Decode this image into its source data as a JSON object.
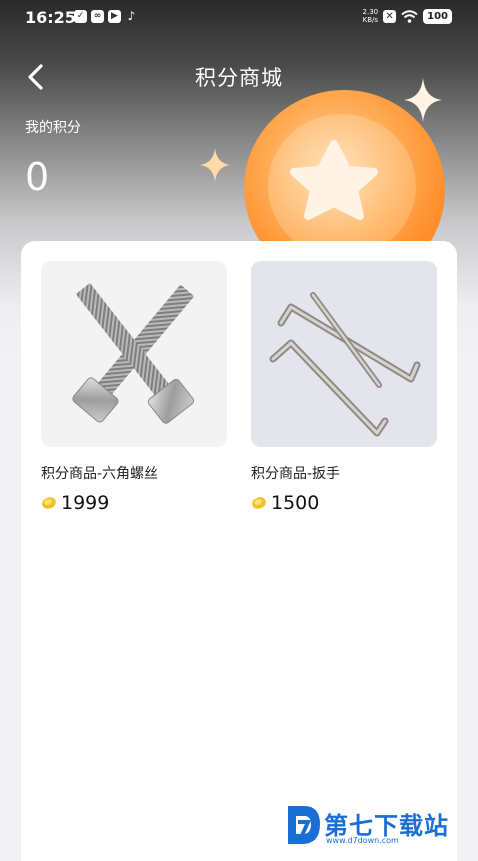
{
  "status_bar": {
    "time": "16:25",
    "speed_value": "2.30",
    "speed_unit": "KB/s",
    "battery": "100"
  },
  "header": {
    "title": "积分商城"
  },
  "points": {
    "label": "我的积分",
    "value": "0"
  },
  "products": [
    {
      "name": "积分商品-六角螺丝",
      "price": "1999",
      "image": "hex-bolts"
    },
    {
      "name": "积分商品-扳手",
      "price": "1500",
      "image": "hex-wrenches"
    }
  ],
  "watermark": {
    "text": "第七下载站",
    "url": "www.d7down.com"
  },
  "colors": {
    "coin_orange": "#ff9a3c",
    "watermark_blue": "#1a6fd6"
  }
}
